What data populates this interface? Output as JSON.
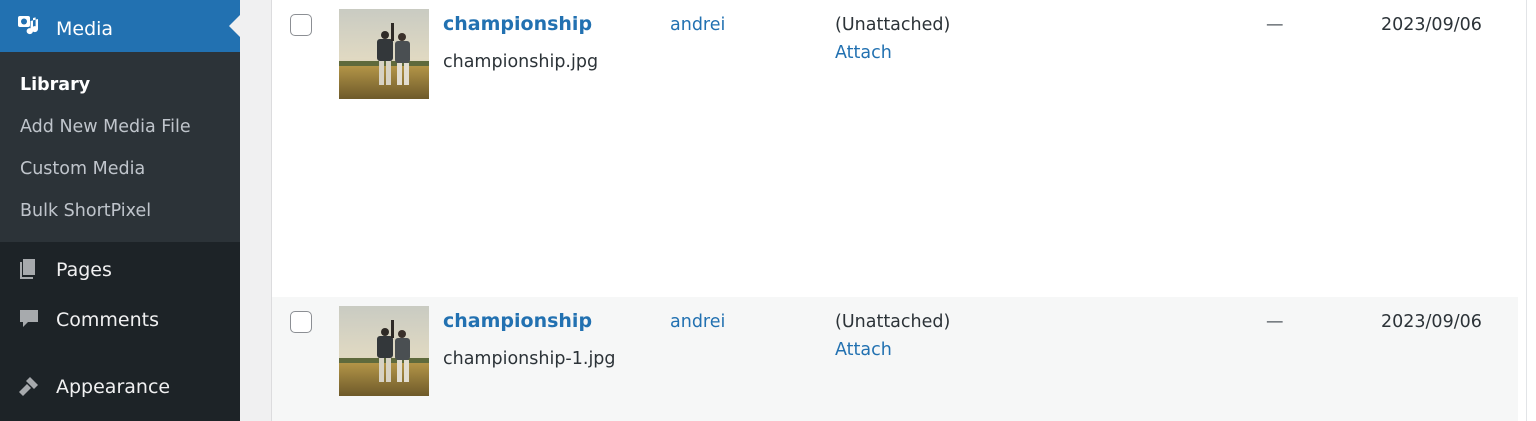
{
  "sidebar": {
    "media": {
      "label": "Media",
      "icon": "media-icon"
    },
    "submenu": [
      {
        "label": "Library",
        "current": true
      },
      {
        "label": "Add New Media File"
      },
      {
        "label": "Custom Media"
      },
      {
        "label": "Bulk ShortPixel"
      }
    ],
    "items": [
      {
        "label": "Pages",
        "icon": "pages-icon"
      },
      {
        "label": "Comments",
        "icon": "comments-icon"
      },
      {
        "label": "Appearance",
        "icon": "appearance-icon"
      }
    ]
  },
  "media_rows": [
    {
      "title": "championship",
      "filename": "championship.jpg",
      "author": "andrei",
      "uploaded_to": "(Unattached)",
      "attach_label": "Attach",
      "comments": "—",
      "date": "2023/09/06"
    },
    {
      "title": "championship",
      "filename": "championship-1.jpg",
      "author": "andrei",
      "uploaded_to": "(Unattached)",
      "attach_label": "Attach",
      "comments": "—",
      "date": "2023/09/06"
    }
  ],
  "colors": {
    "sidebar_bg": "#1d2327",
    "submenu_bg": "#2c3338",
    "accent": "#2271b1",
    "alt_row": "#f6f7f7"
  }
}
